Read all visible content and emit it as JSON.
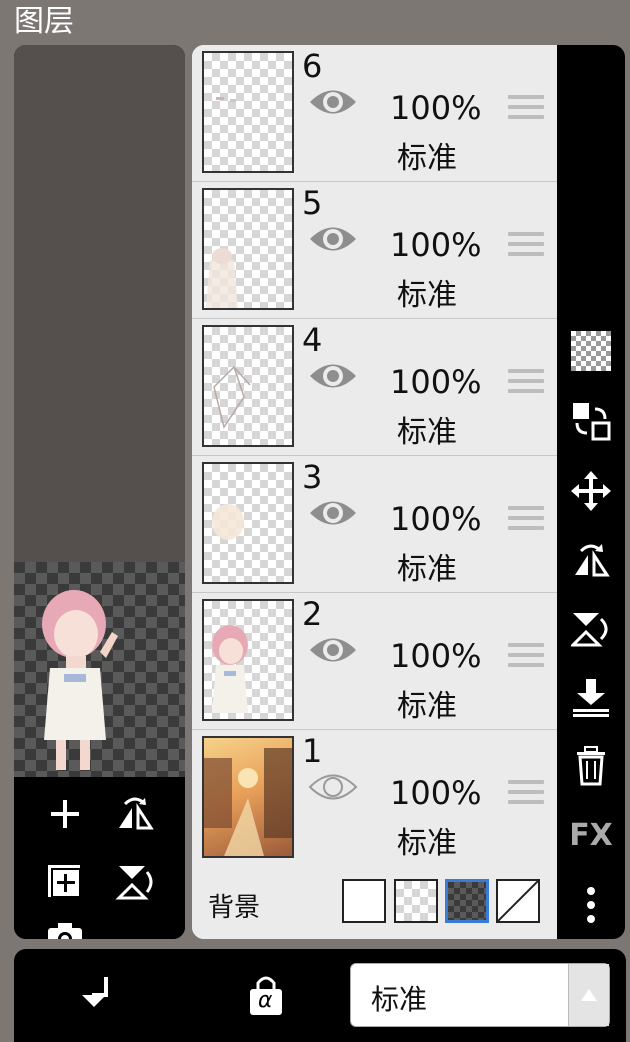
{
  "title": "图层",
  "layers": [
    {
      "number": "6",
      "opacity": "100%",
      "blend": "标准",
      "visible": true
    },
    {
      "number": "5",
      "opacity": "100%",
      "blend": "标准",
      "visible": true
    },
    {
      "number": "4",
      "opacity": "100%",
      "blend": "标准",
      "visible": true
    },
    {
      "number": "3",
      "opacity": "100%",
      "blend": "标准",
      "visible": true
    },
    {
      "number": "2",
      "opacity": "100%",
      "blend": "标准",
      "visible": true
    },
    {
      "number": "1",
      "opacity": "100%",
      "blend": "标准",
      "visible": false
    }
  ],
  "background": {
    "label": "背景",
    "options": [
      "white",
      "transparent",
      "dark-transparent",
      "none"
    ],
    "selected": "dark-transparent"
  },
  "left_tools": [
    "add-layer-icon",
    "flip-horizontal-icon",
    "add-layer-copy-icon",
    "flip-vertical-icon",
    "camera-icon"
  ],
  "right_tools": [
    "transparency-icon",
    "swap-layer-icon",
    "move-icon",
    "flip-layer-horizontal-icon",
    "flip-layer-vertical-icon",
    "merge-down-icon",
    "delete-icon",
    "fx-icon",
    "more-icon"
  ],
  "fx_label": "FX",
  "bottom": {
    "blend_mode": "标准",
    "tools": [
      "clip-arrow-icon",
      "alpha-lock-icon"
    ],
    "alpha_symbol": "α"
  },
  "colors": {
    "accent_select": "#3a7bd5",
    "panel": "#000000",
    "list_bg": "#ebebeb"
  }
}
